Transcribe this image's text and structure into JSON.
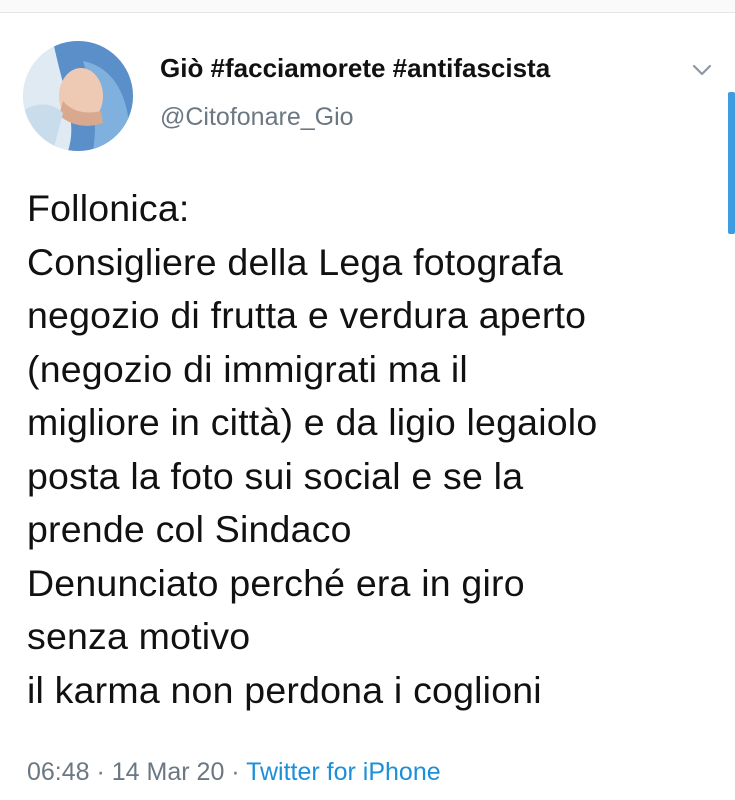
{
  "author": {
    "display_name": "Giò #facciamorete #antifascista",
    "handle": "@Citofonare_Gio"
  },
  "tweet": {
    "lines": [
      "Follonica:",
      "Consigliere della Lega fotografa",
      "negozio di frutta e verdura aperto",
      "(negozio di immigrati ma il",
      "migliore in città) e da ligio legaiolo",
      "posta la foto sui social e se la",
      "prende col Sindaco",
      "Denunciato perché era in giro",
      "senza motivo",
      "il karma non perdona i coglioni"
    ],
    "time": "06:48",
    "sep1": " · ",
    "date": "14 Mar 20",
    "sep2": " · ",
    "source": "Twitter for iPhone"
  },
  "icons": {
    "menu": "chevron-down-icon",
    "avatar": "avatar"
  },
  "colors": {
    "accent": "#1d8fd8",
    "secondary_text": "#6b7782",
    "scroll_indicator": "#3e9de0"
  }
}
